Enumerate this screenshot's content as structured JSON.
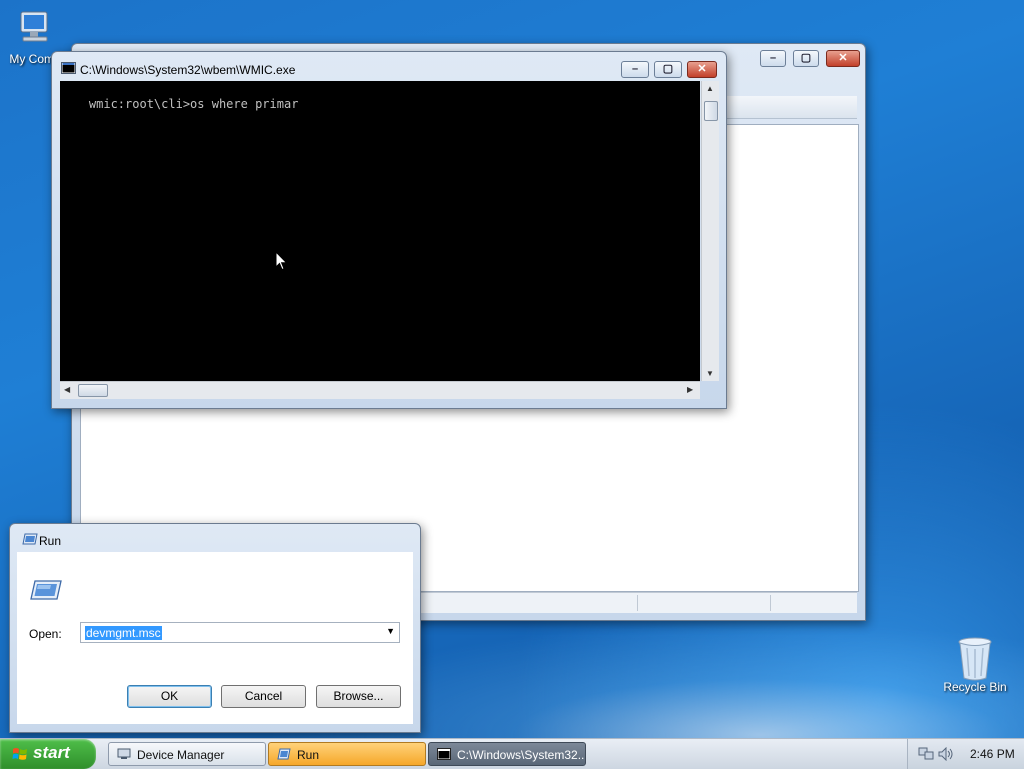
{
  "desktop": {
    "icons": [
      {
        "label": "My Comp",
        "icon": "computer-icon"
      },
      {
        "label": "Recycle Bin",
        "icon": "recycle-bin-icon"
      }
    ]
  },
  "background_window": {
    "title": ""
  },
  "wmic_window": {
    "title": "C:\\Windows\\System32\\wbem\\WMIC.exe",
    "console_text": "wmic:root\\cli>os where primar",
    "colors": {
      "console_bg": "#000000",
      "console_fg": "#c0c0c0"
    }
  },
  "run_dialog": {
    "title": "Run",
    "open_label": "Open:",
    "open_value": "devmgmt.msc",
    "ok_label": "OK",
    "cancel_label": "Cancel",
    "browse_label": "Browse..."
  },
  "taskbar": {
    "start_label": "start",
    "tasks": [
      {
        "label": "Device Manager"
      },
      {
        "label": "Run"
      },
      {
        "label": "C:\\Windows\\System32..."
      }
    ],
    "clock": "2:46 PM"
  }
}
